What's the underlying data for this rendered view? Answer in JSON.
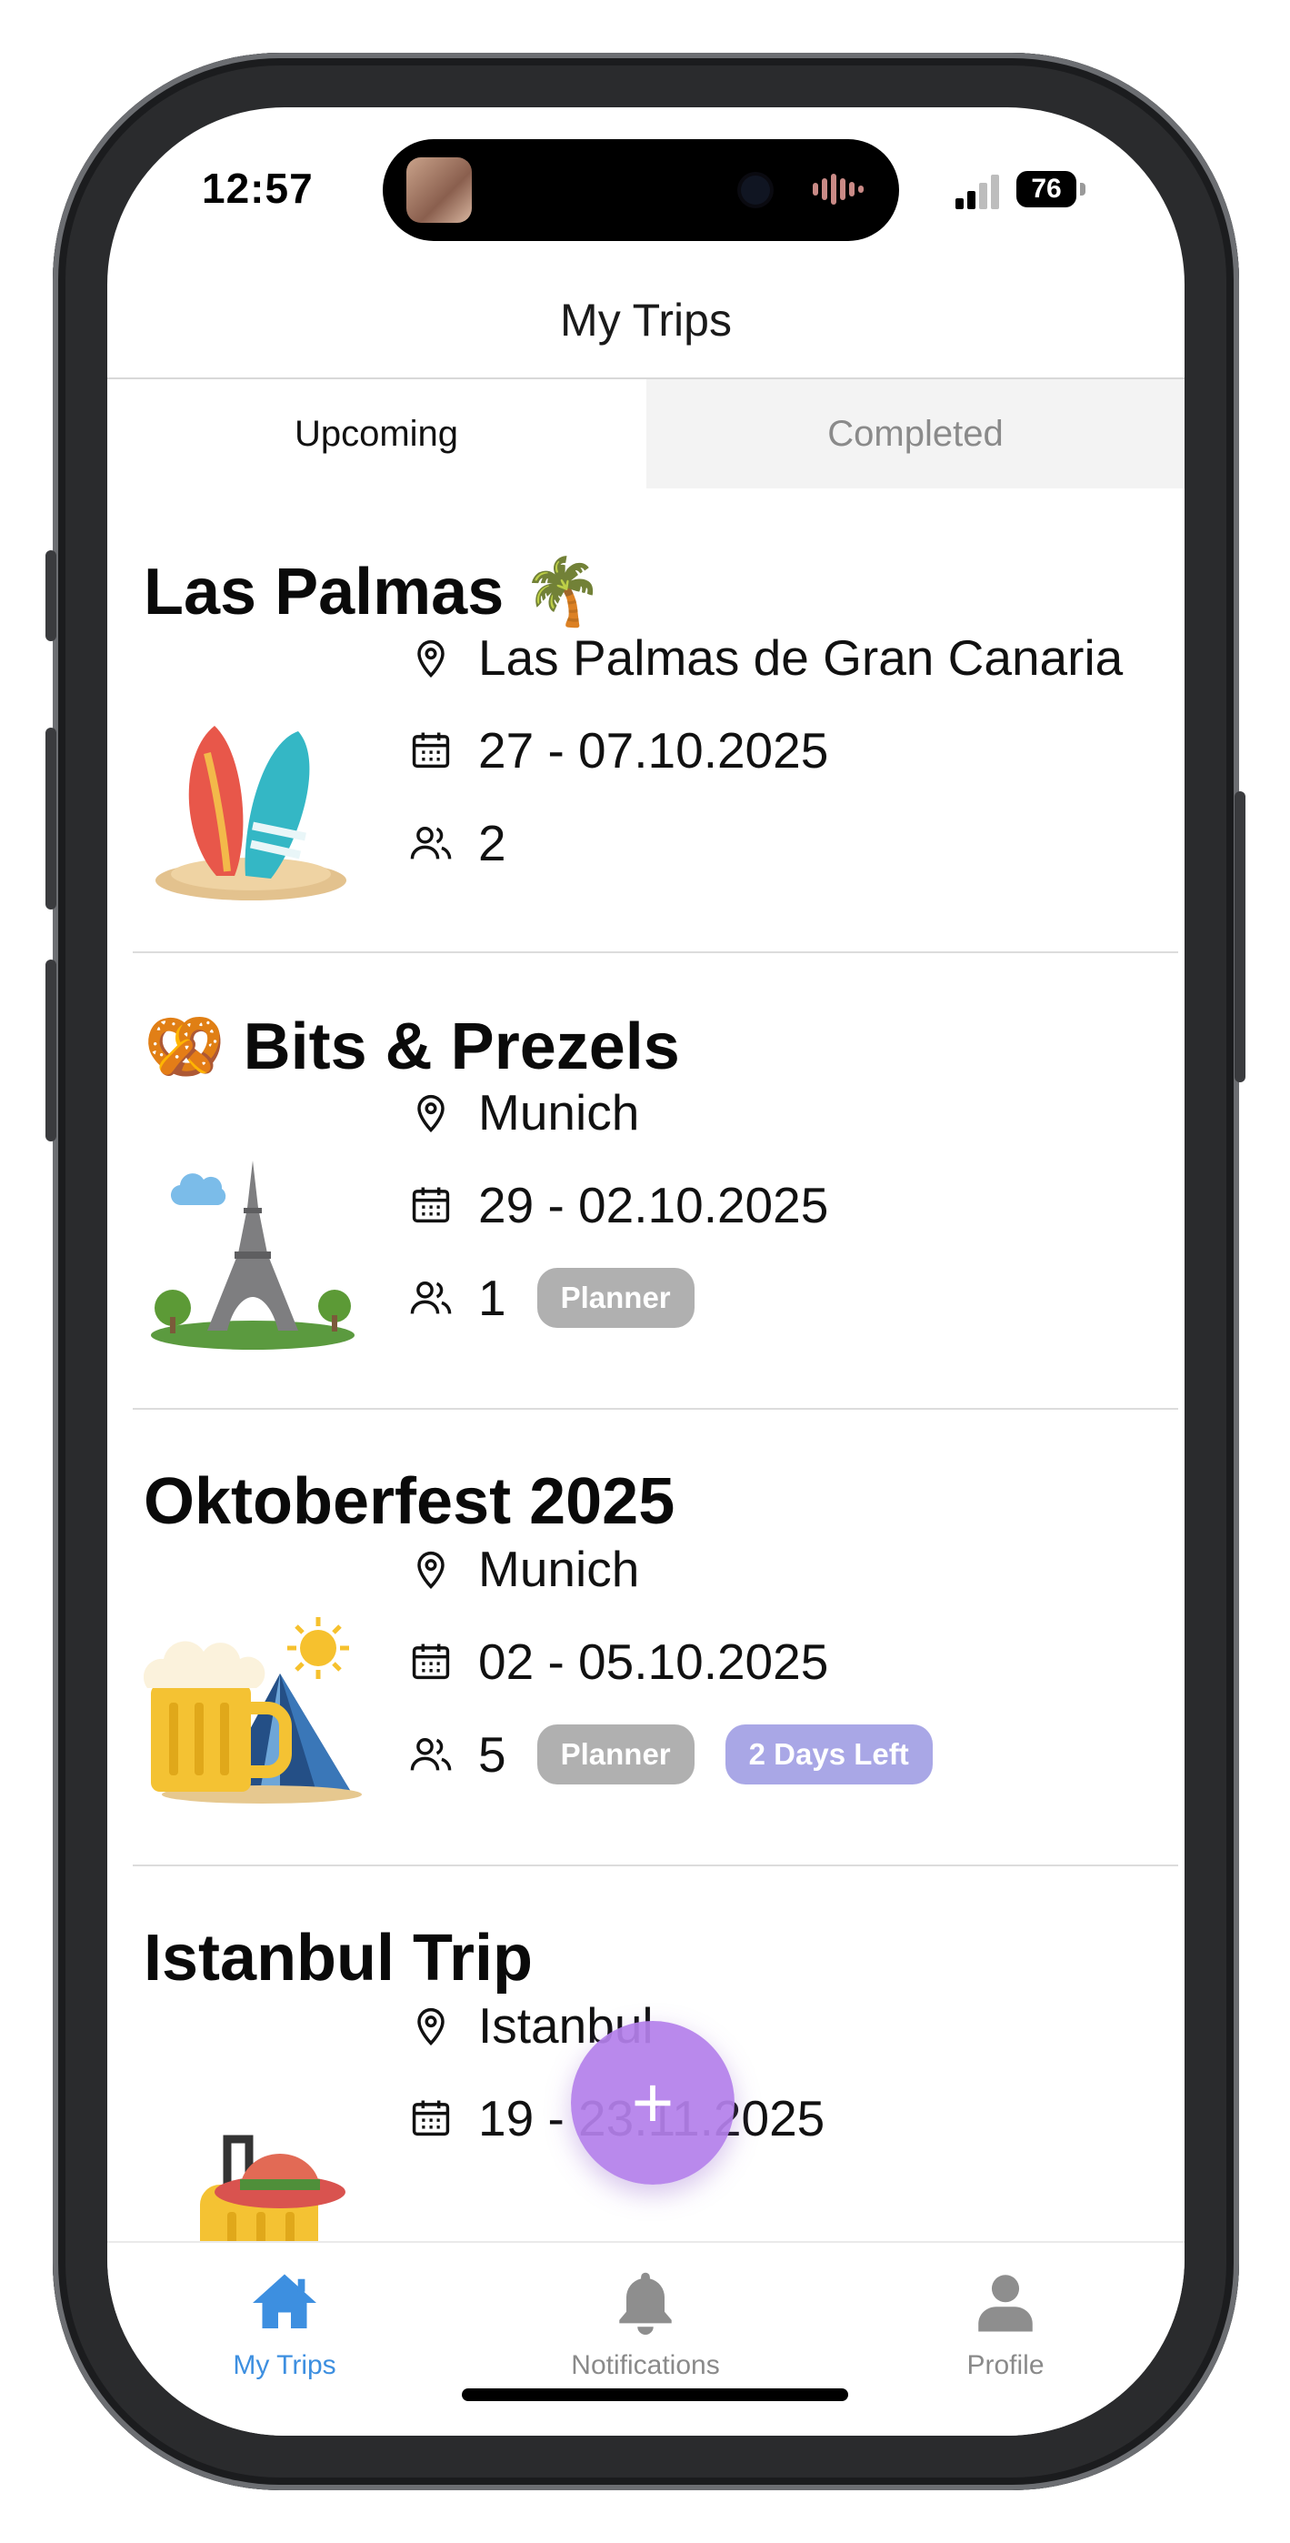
{
  "status_bar": {
    "time": "12:57",
    "battery": "76"
  },
  "header": {
    "title": "My Trips"
  },
  "tabs": [
    {
      "label": "Upcoming",
      "selected": true
    },
    {
      "label": "Completed",
      "selected": false
    }
  ],
  "trips": [
    {
      "title": "Las Palmas 🌴",
      "location": "Las Palmas de Gran Canaria",
      "dates": "27 - 07.10.2025",
      "participants": "2",
      "badges": [],
      "art_icon": "surfboards-icon"
    },
    {
      "title": "🥨 Bits & Prezels",
      "location": "Munich",
      "dates": "29 - 02.10.2025",
      "participants": "1",
      "badges": [
        "Planner"
      ],
      "art_icon": "eiffel-tower-icon"
    },
    {
      "title": "Oktoberfest 2025",
      "location": "Munich",
      "dates": "02 - 05.10.2025",
      "participants": "5",
      "badges": [
        "Planner",
        "2 Days Left"
      ],
      "art_icon": "beer-tent-icon"
    },
    {
      "title": "Istanbul Trip",
      "location": "Istanbul",
      "dates": "19 - 23.11.2025",
      "participants": "",
      "badges": [],
      "art_icon": "suitcase-icon"
    }
  ],
  "fab": {
    "label": "+"
  },
  "bottom_nav": [
    {
      "label": "My Trips",
      "icon": "home-icon",
      "active": true
    },
    {
      "label": "Notifications",
      "icon": "bell-icon",
      "active": false
    },
    {
      "label": "Profile",
      "icon": "person-icon",
      "active": false
    }
  ],
  "colors": {
    "accent": "#3d8fe0",
    "fab": "#b480eb",
    "badge_grey": "#b0b0b0",
    "badge_purple": "#a9a7e6"
  }
}
